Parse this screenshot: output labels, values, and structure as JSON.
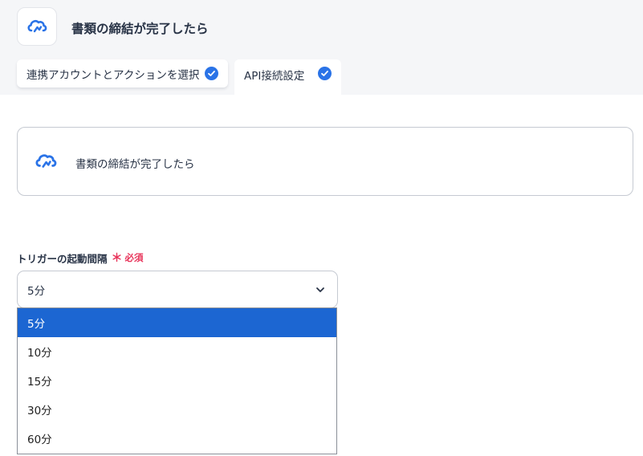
{
  "header": {
    "title": "書類の締結が完了したら",
    "app_icon": "cloud-sign-icon"
  },
  "tabs": [
    {
      "label": "連携アカウントとアクションを選択",
      "completed": true
    },
    {
      "label": "API接続設定",
      "completed": true
    }
  ],
  "app_card": {
    "title": "書類の締結が完了したら",
    "icon": "cloud-sign-icon"
  },
  "field": {
    "label": "トリガーの起動間隔",
    "required_mark": "＊",
    "required_text": "必須",
    "value": "5分"
  },
  "dropdown": {
    "options": [
      "5分",
      "10分",
      "15分",
      "30分",
      "60分"
    ],
    "selected": "5分"
  },
  "colors": {
    "accent": "#2a73e7",
    "selected_option": "#1c66d2",
    "required": "#e8355b",
    "header_band": "#f5f6f8"
  }
}
